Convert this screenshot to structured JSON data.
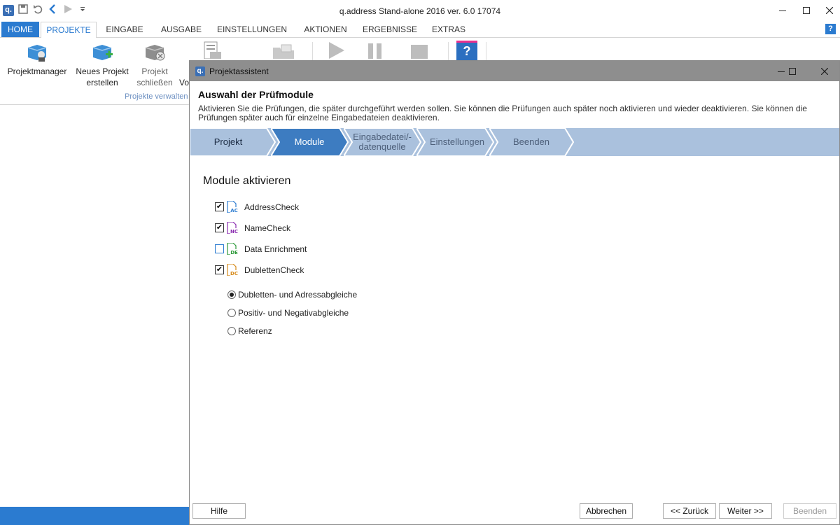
{
  "window": {
    "title": "q.address Stand-alone 2016 ver. 6.0 17074",
    "app_icon": "q."
  },
  "tabs": [
    "HOME",
    "PROJEKTE",
    "EINGABE",
    "AUSGABE",
    "EINSTELLUNGEN",
    "AKTIONEN",
    "ERGEBNISSE",
    "EXTRAS"
  ],
  "help_badge": "?",
  "ribbon": {
    "projektmanager": "Projektmanager",
    "neues_projekt_1": "Neues Projekt",
    "neues_projekt_2": "erstellen",
    "schliessen_1": "Projekt",
    "schliessen_2": "schließen",
    "vo": "Vo",
    "group_label": "Projekte verwalten",
    "help_icon": "?"
  },
  "dialog": {
    "icon": "q.",
    "title": "Projektassistent",
    "heading": "Auswahl der Prüfmodule",
    "description": "Aktivieren Sie die Prüfungen, die später durchgeführt werden sollen. Sie können die Prüfungen auch später noch aktivieren und wieder deaktivieren. Sie können die Prüfungen später auch für einzelne Eingabedateien deaktivieren.",
    "steps": [
      "Projekt",
      "Module",
      "Eingabedatei/-\ndatenquelle",
      "Einstellungen",
      "Beenden"
    ],
    "section_title": "Module aktivieren",
    "modules": [
      {
        "label": "AddressCheck",
        "checked": "✔",
        "icon_text": "AC",
        "color": "#2b7bd0"
      },
      {
        "label": "NameCheck",
        "checked": "✔",
        "icon_text": "NC",
        "color": "#8a2bb0"
      },
      {
        "label": "Data Enrichment",
        "checked": "",
        "icon_text": "DE",
        "color": "#2e9a3a"
      },
      {
        "label": "DublettenCheck",
        "checked": "✔",
        "icon_text": "DC",
        "color": "#d68a1a"
      }
    ],
    "radios": [
      {
        "label": "Dubletten- und Adressabgleiche",
        "selected": true
      },
      {
        "label": "Positiv- und Negativabgleiche",
        "selected": false
      },
      {
        "label": "Referenz",
        "selected": false
      }
    ],
    "buttons": {
      "hilfe": "Hilfe",
      "abbrechen": "Abbrechen",
      "zurueck": "<< Zurück",
      "weiter": "Weiter >>",
      "beenden": "Beenden"
    }
  }
}
